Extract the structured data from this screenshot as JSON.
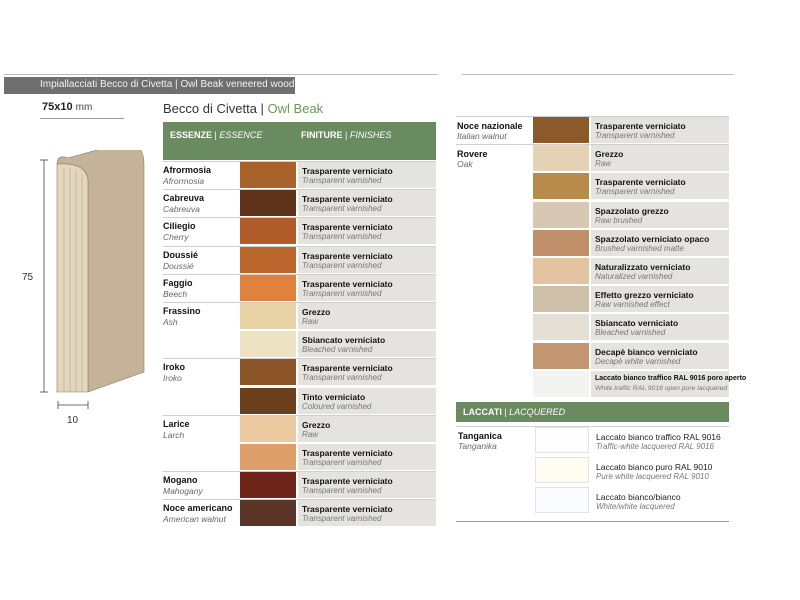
{
  "header": {
    "title_it": "Impiallacciati Becco di Civetta",
    "title_en": "Owl Beak veneered wood"
  },
  "drawing": {
    "size_label": "75x10",
    "size_unit": "mm",
    "height_label": "75",
    "width_label": "10"
  },
  "product": {
    "name_it": "Becco di Civetta",
    "name_en": "Owl Beak"
  },
  "left_table": {
    "col1_it": "ESSENZE",
    "col1_en": "ESSENCE",
    "col2_it": "FINITURE",
    "col2_en": "FINISHES",
    "rows": [
      {
        "name": "Afrormosia",
        "name_en": "Afrormosia",
        "finish": "Trasparente verniciato",
        "finish_en": "Transparent varnished",
        "color": "#a9622a"
      },
      {
        "name": "Cabreuva",
        "name_en": "Cabreuva",
        "finish": "Trasparente verniciato",
        "finish_en": "Transparent varnished",
        "color": "#5e3119"
      },
      {
        "name": "Ciliegio",
        "name_en": "Cherry",
        "finish": "Trasparente verniciato",
        "finish_en": "Transparent varnished",
        "color": "#b05b2a"
      },
      {
        "name": "Doussié",
        "name_en": "Doussié",
        "finish": "Trasparente verniciato",
        "finish_en": "Transparent varnished",
        "color": "#b9652c"
      },
      {
        "name": "Faggio",
        "name_en": "Beech",
        "finish": "Trasparente verniciato",
        "finish_en": "Transparent varnished",
        "color": "#e0823e"
      },
      {
        "name": "Frassino",
        "name_en": "Ash",
        "finish": "Grezzo",
        "finish_en": "Raw",
        "color": "#e8d3a7"
      },
      {
        "name": "",
        "name_en": "",
        "finish": "Sbiancato verniciato",
        "finish_en": "Bleached varnished",
        "color": "#eee2c4"
      },
      {
        "name": "Iroko",
        "name_en": "Iroko",
        "finish": "Trasparente verniciato",
        "finish_en": "Transparent varnished",
        "color": "#8c5628"
      },
      {
        "name": "",
        "name_en": "",
        "finish": "Tinto verniciato",
        "finish_en": "Coloured varnished",
        "color": "#6b3f1b"
      },
      {
        "name": "Larice",
        "name_en": "Larch",
        "finish": "Grezzo",
        "finish_en": "Raw",
        "color": "#ecc9a0"
      },
      {
        "name": "",
        "name_en": "",
        "finish": "Trasparente verniciato",
        "finish_en": "Transparent varnished",
        "color": "#dea06a"
      },
      {
        "name": "Mogano",
        "name_en": "Mahogany",
        "finish": "Trasparente verniciato",
        "finish_en": "Transparent varnished",
        "color": "#6e2418"
      },
      {
        "name": "Noce americano",
        "name_en": "American walnut",
        "finish": "Trasparente verniciato",
        "finish_en": "Transparent varnished",
        "color": "#5a3424"
      }
    ]
  },
  "right_table": {
    "rows": [
      {
        "name": "Noce nazionale",
        "name_en": "Italian walnut",
        "finish": "Trasparente verniciato",
        "finish_en": "Transparent varnished",
        "color": "#8a5a2b"
      },
      {
        "name": "Rovere",
        "name_en": "Oak",
        "finish": "Grezzo",
        "finish_en": "Raw",
        "color": "#e6d2b4"
      },
      {
        "name": "",
        "name_en": "",
        "finish": "Trasparente verniciato",
        "finish_en": "Transparent varnished",
        "color": "#b88a4c"
      },
      {
        "name": "",
        "name_en": "",
        "finish": "Spazzolato grezzo",
        "finish_en": "Raw brushed",
        "color": "#d6c8b2"
      },
      {
        "name": "",
        "name_en": "",
        "finish": "Spazzolato verniciato opaco",
        "finish_en": "Brushed varnished matte",
        "color": "#c0906a"
      },
      {
        "name": "",
        "name_en": "",
        "finish": "Naturalizzato verniciato",
        "finish_en": "Naturalized varnished",
        "color": "#e4c3a0"
      },
      {
        "name": "",
        "name_en": "",
        "finish": "Effetto grezzo verniciato",
        "finish_en": "Raw varnished effect",
        "color": "#cdbfa8"
      },
      {
        "name": "",
        "name_en": "",
        "finish": "Sbiancato verniciato",
        "finish_en": "Bleached varnished",
        "color": "#e5e0d6"
      },
      {
        "name": "",
        "name_en": "",
        "finish": "Decapè bianco verniciato",
        "finish_en": "Decapè white varnished",
        "color": "#c29670"
      },
      {
        "name": "",
        "name_en": "",
        "finish": "Laccato bianco traffico RAL 9016 poro aperto",
        "finish_en": "White traffic RAL 9016 open pore lacquered",
        "color": "#f3f3f1"
      }
    ],
    "lacquer_header_it": "LACCATI",
    "lacquer_header_en": "LACQUERED",
    "lacquer_name": "Tanganica",
    "lacquer_name_en": "Tanganika",
    "lacquer_rows": [
      {
        "finish": "Laccato bianco traffico RAL 9016",
        "finish_en": "Traffic-white lacquered RAL 9016",
        "color": "#fdfdfd"
      },
      {
        "finish": "Laccato bianco puro RAL 9010",
        "finish_en": "Pure white lacquered RAL 9010",
        "color": "#fffcf2"
      },
      {
        "finish": "Laccato bianco/bianco",
        "finish_en": "White/white lacquered",
        "color": "#fafcff"
      }
    ]
  }
}
